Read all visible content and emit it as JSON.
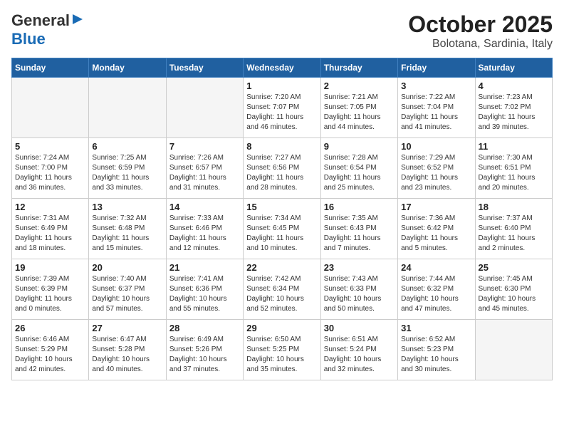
{
  "header": {
    "logo_general": "General",
    "logo_blue": "Blue",
    "title": "October 2025",
    "subtitle": "Bolotana, Sardinia, Italy"
  },
  "days_of_week": [
    "Sunday",
    "Monday",
    "Tuesday",
    "Wednesday",
    "Thursday",
    "Friday",
    "Saturday"
  ],
  "weeks": [
    [
      {
        "day": "",
        "info": ""
      },
      {
        "day": "",
        "info": ""
      },
      {
        "day": "",
        "info": ""
      },
      {
        "day": "1",
        "info": "Sunrise: 7:20 AM\nSunset: 7:07 PM\nDaylight: 11 hours\nand 46 minutes."
      },
      {
        "day": "2",
        "info": "Sunrise: 7:21 AM\nSunset: 7:05 PM\nDaylight: 11 hours\nand 44 minutes."
      },
      {
        "day": "3",
        "info": "Sunrise: 7:22 AM\nSunset: 7:04 PM\nDaylight: 11 hours\nand 41 minutes."
      },
      {
        "day": "4",
        "info": "Sunrise: 7:23 AM\nSunset: 7:02 PM\nDaylight: 11 hours\nand 39 minutes."
      }
    ],
    [
      {
        "day": "5",
        "info": "Sunrise: 7:24 AM\nSunset: 7:00 PM\nDaylight: 11 hours\nand 36 minutes."
      },
      {
        "day": "6",
        "info": "Sunrise: 7:25 AM\nSunset: 6:59 PM\nDaylight: 11 hours\nand 33 minutes."
      },
      {
        "day": "7",
        "info": "Sunrise: 7:26 AM\nSunset: 6:57 PM\nDaylight: 11 hours\nand 31 minutes."
      },
      {
        "day": "8",
        "info": "Sunrise: 7:27 AM\nSunset: 6:56 PM\nDaylight: 11 hours\nand 28 minutes."
      },
      {
        "day": "9",
        "info": "Sunrise: 7:28 AM\nSunset: 6:54 PM\nDaylight: 11 hours\nand 25 minutes."
      },
      {
        "day": "10",
        "info": "Sunrise: 7:29 AM\nSunset: 6:52 PM\nDaylight: 11 hours\nand 23 minutes."
      },
      {
        "day": "11",
        "info": "Sunrise: 7:30 AM\nSunset: 6:51 PM\nDaylight: 11 hours\nand 20 minutes."
      }
    ],
    [
      {
        "day": "12",
        "info": "Sunrise: 7:31 AM\nSunset: 6:49 PM\nDaylight: 11 hours\nand 18 minutes."
      },
      {
        "day": "13",
        "info": "Sunrise: 7:32 AM\nSunset: 6:48 PM\nDaylight: 11 hours\nand 15 minutes."
      },
      {
        "day": "14",
        "info": "Sunrise: 7:33 AM\nSunset: 6:46 PM\nDaylight: 11 hours\nand 12 minutes."
      },
      {
        "day": "15",
        "info": "Sunrise: 7:34 AM\nSunset: 6:45 PM\nDaylight: 11 hours\nand 10 minutes."
      },
      {
        "day": "16",
        "info": "Sunrise: 7:35 AM\nSunset: 6:43 PM\nDaylight: 11 hours\nand 7 minutes."
      },
      {
        "day": "17",
        "info": "Sunrise: 7:36 AM\nSunset: 6:42 PM\nDaylight: 11 hours\nand 5 minutes."
      },
      {
        "day": "18",
        "info": "Sunrise: 7:37 AM\nSunset: 6:40 PM\nDaylight: 11 hours\nand 2 minutes."
      }
    ],
    [
      {
        "day": "19",
        "info": "Sunrise: 7:39 AM\nSunset: 6:39 PM\nDaylight: 11 hours\nand 0 minutes."
      },
      {
        "day": "20",
        "info": "Sunrise: 7:40 AM\nSunset: 6:37 PM\nDaylight: 10 hours\nand 57 minutes."
      },
      {
        "day": "21",
        "info": "Sunrise: 7:41 AM\nSunset: 6:36 PM\nDaylight: 10 hours\nand 55 minutes."
      },
      {
        "day": "22",
        "info": "Sunrise: 7:42 AM\nSunset: 6:34 PM\nDaylight: 10 hours\nand 52 minutes."
      },
      {
        "day": "23",
        "info": "Sunrise: 7:43 AM\nSunset: 6:33 PM\nDaylight: 10 hours\nand 50 minutes."
      },
      {
        "day": "24",
        "info": "Sunrise: 7:44 AM\nSunset: 6:32 PM\nDaylight: 10 hours\nand 47 minutes."
      },
      {
        "day": "25",
        "info": "Sunrise: 7:45 AM\nSunset: 6:30 PM\nDaylight: 10 hours\nand 45 minutes."
      }
    ],
    [
      {
        "day": "26",
        "info": "Sunrise: 6:46 AM\nSunset: 5:29 PM\nDaylight: 10 hours\nand 42 minutes."
      },
      {
        "day": "27",
        "info": "Sunrise: 6:47 AM\nSunset: 5:28 PM\nDaylight: 10 hours\nand 40 minutes."
      },
      {
        "day": "28",
        "info": "Sunrise: 6:49 AM\nSunset: 5:26 PM\nDaylight: 10 hours\nand 37 minutes."
      },
      {
        "day": "29",
        "info": "Sunrise: 6:50 AM\nSunset: 5:25 PM\nDaylight: 10 hours\nand 35 minutes."
      },
      {
        "day": "30",
        "info": "Sunrise: 6:51 AM\nSunset: 5:24 PM\nDaylight: 10 hours\nand 32 minutes."
      },
      {
        "day": "31",
        "info": "Sunrise: 6:52 AM\nSunset: 5:23 PM\nDaylight: 10 hours\nand 30 minutes."
      },
      {
        "day": "",
        "info": ""
      }
    ]
  ]
}
